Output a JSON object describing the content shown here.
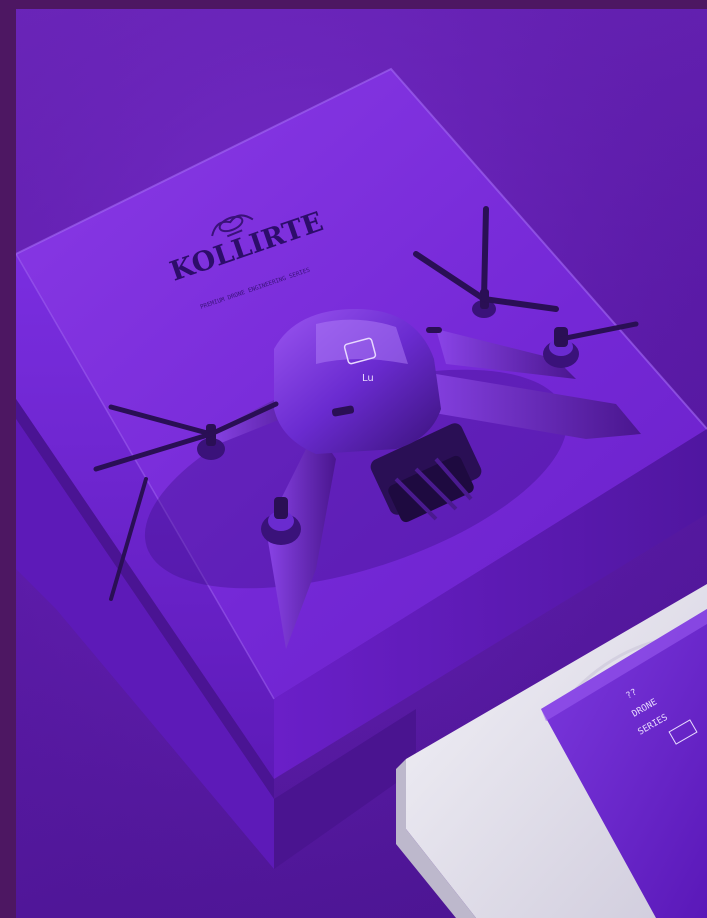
{
  "image": {
    "alt": "Purple drone resting on a purple product box with a printed brand logo, beside a white packaging box holding a purple card"
  },
  "box": {
    "brand_text": "KOLLIRTE",
    "tagline": "PREMIUM DRONE ENGINEERING SERIES"
  },
  "drone": {
    "badge_text": "Lu"
  },
  "card": {
    "line1": "??",
    "line2": "DRONE",
    "line3": "SERIES"
  },
  "colors": {
    "frame": "#4d1762",
    "background": "#6a25b8",
    "box_top": "#7a2fd8",
    "box_side": "#5a19b0",
    "drone_body": "#6a2bd0",
    "drone_dark": "#2a0f55",
    "white_box": "#e8e6ef"
  }
}
